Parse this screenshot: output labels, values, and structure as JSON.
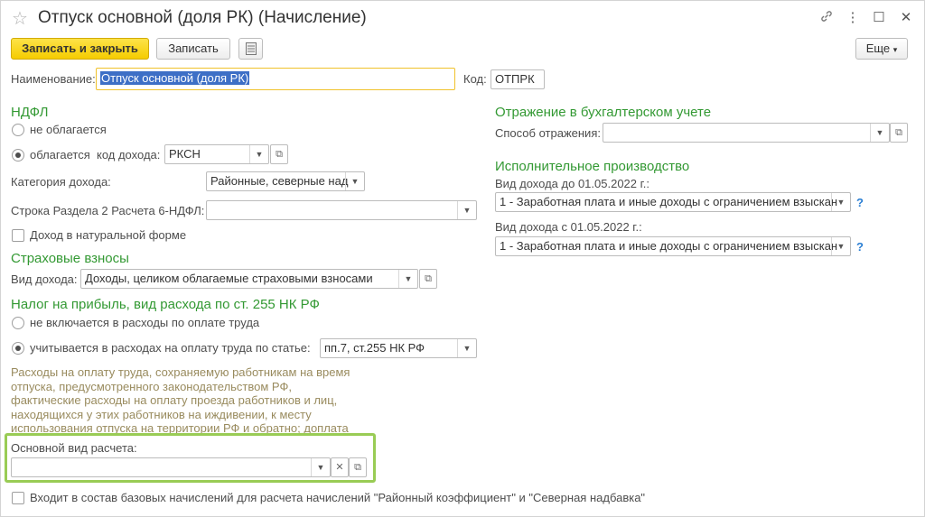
{
  "window": {
    "title": "Отпуск основной (доля РК) (Начисление)",
    "link_icon": "🔗",
    "more_icon": "⋮",
    "maximize_icon": "☐",
    "close_icon": "✕"
  },
  "toolbar": {
    "save_close": "Записать и закрыть",
    "save": "Записать",
    "more": "Еще"
  },
  "name_field": {
    "label": "Наименование:",
    "value": "Отпуск основной (доля РК)"
  },
  "code_field": {
    "label": "Код:",
    "value": "ОТПРК"
  },
  "ndfl": {
    "title": "НДФЛ",
    "radio_not_taxed": "не облагается",
    "radio_taxed": "облагается",
    "income_code_label": "код дохода:",
    "income_code_value": "РКСН",
    "income_category_label": "Категория дохода:",
    "income_category_value": "Районные, северные над",
    "row_label": "Строка Раздела 2 Расчета 6-НДФЛ:",
    "row_value": "",
    "natural_income": "Доход в натуральной форме"
  },
  "insurance": {
    "title": "Страховые взносы",
    "income_type_label": "Вид дохода:",
    "income_type_value": "Доходы, целиком облагаемые страховыми взносами"
  },
  "profit_tax": {
    "title": "Налог на прибыль, вид расхода по ст. 255 НК РФ",
    "radio_excluded": "не включается в расходы по оплате труда",
    "radio_included": "учитывается в расходах на оплату труда по статье:",
    "article_value": "пп.7, ст.255 НК РФ",
    "note": "Расходы на оплату труда, сохраняемую работникам на время отпуска, предусмотренного законодательством РФ, фактические расходы на оплату проезда работников и лиц, находящихся у этих работников на иждивении, к месту использования отпуска на территории РФ и обратно; доплата"
  },
  "main_calc": {
    "label": "Основной вид расчета:",
    "value": ""
  },
  "base_accruals": "Входит в состав базовых начислений для расчета начислений \"Районный коэффициент\" и \"Северная надбавка\"",
  "accounting": {
    "title": "Отражение в бухгалтерском учете",
    "method_label": "Способ отражения:",
    "method_value": ""
  },
  "enforcement": {
    "title": "Исполнительное производство",
    "before_label": "Вид дохода до 01.05.2022 г.:",
    "before_value": "1 - Заработная плата и иные доходы с ограничением взыскан",
    "after_label": "Вид дохода с 01.05.2022 г.:",
    "after_value": "1 - Заработная плата и иные доходы с ограничением взыскан",
    "help": "?"
  },
  "colors": {
    "section": "#339933",
    "primary_button": "#f5cc00",
    "highlight": "#99cc55",
    "note": "#998b5e"
  }
}
